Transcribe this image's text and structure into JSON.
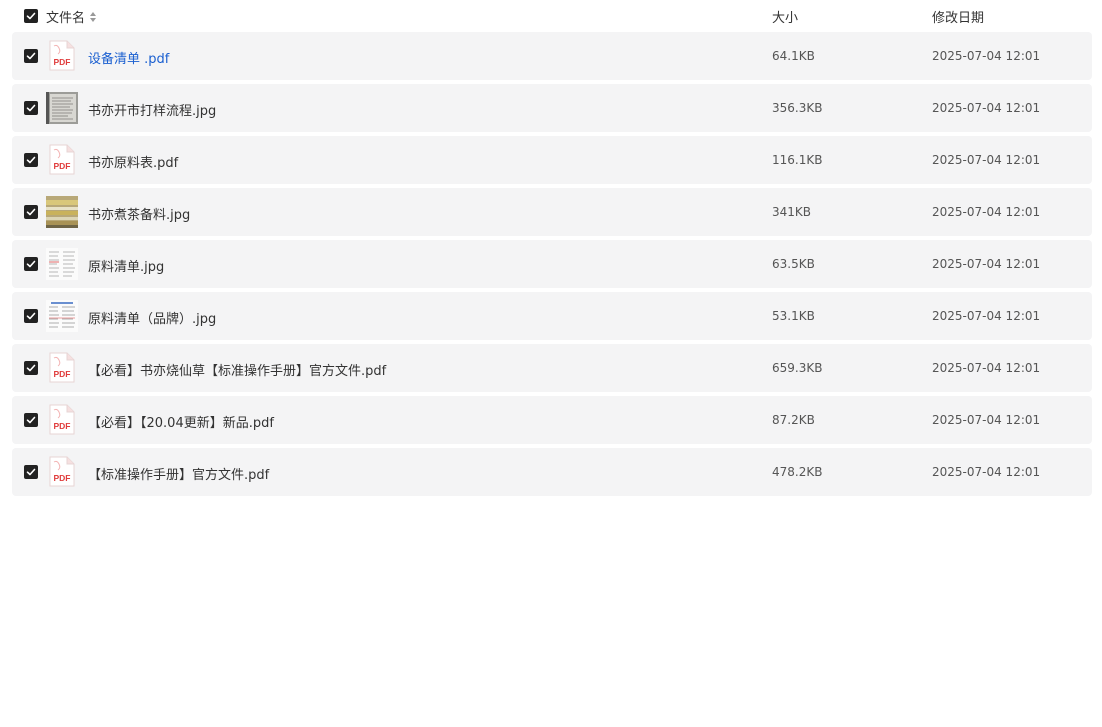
{
  "header": {
    "name_label": "文件名",
    "size_label": "大小",
    "date_label": "修改日期"
  },
  "files": [
    {
      "name": "设备清单 .pdf",
      "type": "pdf",
      "size": "64.1KB",
      "date": "2025-07-04 12:01",
      "active": true
    },
    {
      "name": "书亦开市打样流程.jpg",
      "type": "jpg-doc",
      "size": "356.3KB",
      "date": "2025-07-04 12:01"
    },
    {
      "name": "书亦原料表.pdf",
      "type": "pdf",
      "size": "116.1KB",
      "date": "2025-07-04 12:01"
    },
    {
      "name": "书亦煮茶备料.jpg",
      "type": "jpg-photo",
      "size": "341KB",
      "date": "2025-07-04 12:01"
    },
    {
      "name": "原料清单.jpg",
      "type": "jpg-list",
      "size": "63.5KB",
      "date": "2025-07-04 12:01"
    },
    {
      "name": "原料清单（品牌）.jpg",
      "type": "jpg-list2",
      "size": "53.1KB",
      "date": "2025-07-04 12:01"
    },
    {
      "name": "【必看】书亦烧仙草【标准操作手册】官方文件.pdf",
      "type": "pdf",
      "size": "659.3KB",
      "date": "2025-07-04 12:01"
    },
    {
      "name": "【必看】【20.04更新】新品.pdf",
      "type": "pdf",
      "size": "87.2KB",
      "date": "2025-07-04 12:01"
    },
    {
      "name": "【标准操作手册】官方文件.pdf",
      "type": "pdf",
      "size": "478.2KB",
      "date": "2025-07-04 12:01"
    }
  ],
  "icons": {
    "pdf_label": "PDF",
    "pdf_color": "#e03c3c",
    "check_color": "#222222",
    "link_color": "#1a5fd0"
  }
}
